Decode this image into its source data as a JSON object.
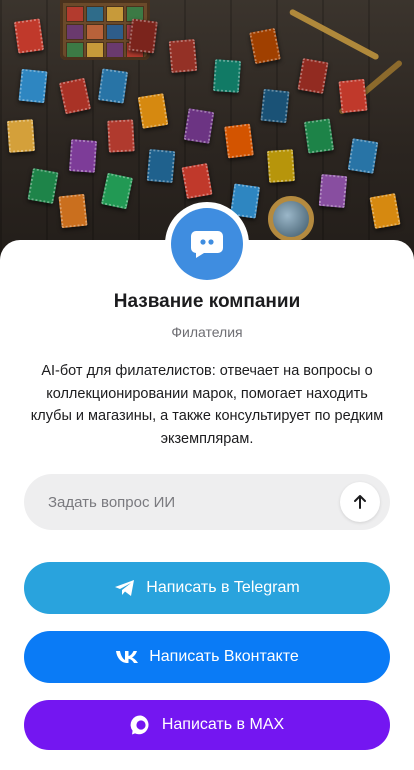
{
  "profile": {
    "company_name": "Название компании",
    "category": "Филателия",
    "description": "AI-бот для филателистов: отвечает на вопросы о коллекционировании марок, помогает находить клубы и магазины, а также консультирует по редким экземплярам."
  },
  "ask": {
    "placeholder": "Задать вопрос ИИ"
  },
  "actions": {
    "telegram_label": "Написать в Telegram",
    "vk_label": "Написать Вконтакте",
    "max_label": "Написать в MAX"
  },
  "icons": {
    "avatar": "chat-bubble-icon",
    "send": "arrow-up-icon",
    "telegram": "telegram-icon",
    "vk": "vk-icon",
    "max": "max-icon"
  },
  "colors": {
    "avatar": "#3f8de0",
    "telegram": "#29a3dd",
    "vk": "#0a7bf6",
    "max": "#7416f1",
    "ask_background": "#eeeeef"
  }
}
